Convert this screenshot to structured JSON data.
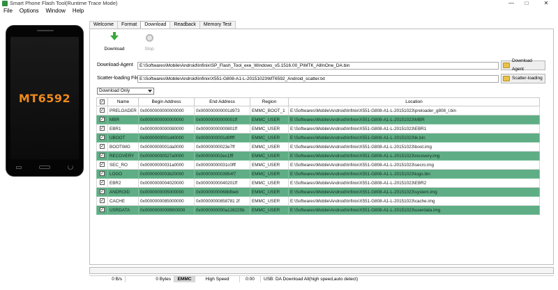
{
  "window": {
    "title": "Smart Phone Flash Tool(Runtime Trace Mode)",
    "minimize": "—",
    "maximize": "□",
    "close": "✕"
  },
  "menu": [
    "File",
    "Options",
    "Window",
    "Help"
  ],
  "device": {
    "chip_label": "MT6592"
  },
  "tabs": [
    {
      "label": "Welcome",
      "active": false
    },
    {
      "label": "Format",
      "active": false
    },
    {
      "label": "Download",
      "active": true
    },
    {
      "label": "Readback",
      "active": false
    },
    {
      "label": "Memory Test",
      "active": false
    }
  ],
  "toolbar": {
    "download_label": "Download",
    "stop_label": "Stop"
  },
  "download_agent": {
    "label": "Download-Agent",
    "path": "E:\\Softwares\\Mobile\\Android\\Infinix\\SP_Flash_Tool_exe_Windows_v5.1516.00_P\\MTK_AllInOne_DA.bin",
    "button": "Download Agent"
  },
  "scatter": {
    "label": "Scatter-loading File",
    "path": "E:\\Softwares\\Mobile\\Android\\Infinix\\X551-G808-A1-L-20151023\\MT6592_Android_scatter.txt",
    "button": "Scatter-loading"
  },
  "mode_select": {
    "value": "Download Only"
  },
  "table": {
    "headers": [
      "",
      "Name",
      "Begin Address",
      "End Address",
      "Region",
      "Location"
    ],
    "rows": [
      {
        "checked": true,
        "name": "PRELOADER",
        "begin": "0x0000000000000000",
        "end": "0x000000000001d973",
        "region": "EMMC_BOOT_1",
        "location": "E:\\Softwares\\Mobile\\Android\\Infinix\\X551-G808-A1-L-20151023\\preloader_g808_l.bin",
        "highlight": false
      },
      {
        "checked": true,
        "name": "MBR",
        "begin": "0x0000000000000000",
        "end": "0x00000000000001ff",
        "region": "EMMC_USER",
        "location": "E:\\Softwares\\Mobile\\Android\\Infinix\\X551-G808-A1-L-20151023\\MBR",
        "highlight": true
      },
      {
        "checked": true,
        "name": "EBR1",
        "begin": "0x0000000000080000",
        "end": "0x00000000000801ff",
        "region": "EMMC_USER",
        "location": "E:\\Softwares\\Mobile\\Android\\Infinix\\X551-G808-A1-L-20151023\\EBR1",
        "highlight": false
      },
      {
        "checked": true,
        "name": "UBOOT",
        "begin": "0x0000000001d40000",
        "end": "0x0000000001d9ffff",
        "region": "EMMC_USER",
        "location": "E:\\Softwares\\Mobile\\Android\\Infinix\\X551-G808-A1-L-20151023\\lk.bin",
        "highlight": true
      },
      {
        "checked": true,
        "name": "BOOTIMG",
        "begin": "0x0000000001da0000",
        "end": "0x00000000023e7ff",
        "region": "EMMC_USER",
        "location": "E:\\Softwares\\Mobile\\Android\\Infinix\\X551-G808-A1-L-20151023\\boot.img",
        "highlight": false
      },
      {
        "checked": true,
        "name": "RECOVERY",
        "begin": "0x00000000027a0000",
        "end": "0x000000002ec1fff",
        "region": "EMMC_USER",
        "location": "E:\\Softwares\\Mobile\\Android\\Infinix\\X551-G808-A1-L-20151023\\recovery.img",
        "highlight": true
      },
      {
        "checked": true,
        "name": "SEC_RO",
        "begin": "0x00000000031a0000",
        "end": "0x00000000031c0fff",
        "region": "EMMC_USER",
        "location": "E:\\Softwares\\Mobile\\Android\\Infinix\\X551-G808-A1-L-20151023\\secro.img",
        "highlight": false
      },
      {
        "checked": true,
        "name": "LOGO",
        "begin": "0x0000000003b20000",
        "end": "0x0000000003954f7",
        "region": "EMMC_USER",
        "location": "E:\\Softwares\\Mobile\\Android\\Infinix\\X551-G808-A1-L-20151023\\logo.bin",
        "highlight": true
      },
      {
        "checked": true,
        "name": "EBR2",
        "begin": "0x0000000004020000",
        "end": "0x00000000040201ff",
        "region": "EMMC_USER",
        "location": "E:\\Softwares\\Mobile\\Android\\Infinix\\X551-G808-A1-L-20151023\\EBR2",
        "highlight": false
      },
      {
        "checked": true,
        "name": "ANDROID",
        "begin": "0x0000000005000000",
        "end": "0x00000000068bfbeb",
        "region": "EMMC_USER",
        "location": "E:\\Softwares\\Mobile\\Android\\Infinix\\X551-G808-A1-L-20151023\\system.img",
        "highlight": true
      },
      {
        "checked": true,
        "name": "CACHE",
        "begin": "0x0000000085000000",
        "end": "0x00000000858781 2f",
        "region": "EMMC_USER",
        "location": "E:\\Softwares\\Mobile\\Android\\Infinix\\X551-G808-A1-L-20151023\\cache.img",
        "highlight": false
      },
      {
        "checked": true,
        "name": "USRDATA",
        "begin": "0x0000000009f800000",
        "end": "0x0000000000a128225b",
        "region": "EMMC_USER",
        "location": "E:\\Softwares\\Mobile\\Android\\Infinix\\X551-G808-A1-L-20151023\\userdata.img",
        "highlight": true
      }
    ]
  },
  "progress": {
    "value": 0
  },
  "status": {
    "speed": "0 B/s",
    "size": "0 Bytes",
    "storage": "EMMC",
    "mode": "High Speed",
    "time": "0:00",
    "usb": "USB: DA Download All(high speed,auto detect)"
  },
  "colors": {
    "highlight_row": "#5fad85",
    "chip_text": "#ee8a1a",
    "download_arrow": "#3aa83a"
  }
}
